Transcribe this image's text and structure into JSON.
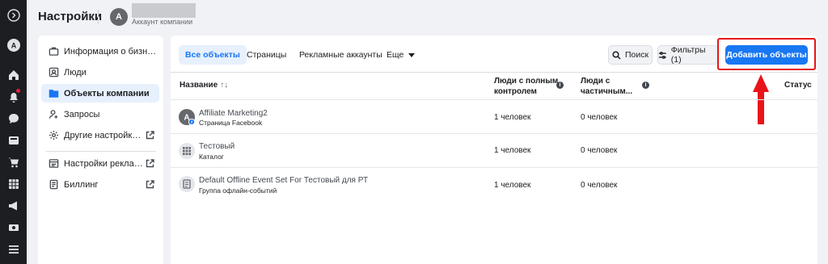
{
  "header": {
    "title": "Настройки",
    "account_initial": "A",
    "account_name": "Аккаунт компании"
  },
  "rail": {
    "icons": [
      "expand-icon",
      "account-icon",
      "home-icon",
      "notifications-icon",
      "chat-icon",
      "pages-icon",
      "shop-icon",
      "table-icon",
      "ads-icon",
      "money-icon",
      "menu-icon"
    ]
  },
  "sidebar": {
    "items": [
      {
        "label": "Информация о бизнес...",
        "icon": "briefcase-icon"
      },
      {
        "label": "Люди",
        "icon": "people-icon"
      },
      {
        "label": "Объекты компании",
        "icon": "folder-icon"
      },
      {
        "label": "Запросы",
        "icon": "user-request-icon"
      },
      {
        "label": "Другие настройки ко...",
        "icon": "gear-icon"
      },
      {
        "label": "Настройки рекламн...",
        "icon": "ad-settings-icon"
      },
      {
        "label": "Биллинг",
        "icon": "billing-icon"
      }
    ]
  },
  "tabs": [
    {
      "label": "Все объекты"
    },
    {
      "label": "Страницы"
    },
    {
      "label": "Рекламные аккаунты"
    },
    {
      "label": "Еще"
    }
  ],
  "toolbar": {
    "search_label": "Поиск",
    "filters_label": "Фильтры (1)",
    "add_label": "Добавить объекты"
  },
  "table": {
    "columns": {
      "name": "Название",
      "full_control_line1": "Люди с полным",
      "full_control_line2": "контролем",
      "partial_line1": "Люди с",
      "partial_line2": "частичным...",
      "status": "Статус"
    },
    "rows": [
      {
        "title": "Affiliate Marketing2",
        "subtitle": "Страница Facebook",
        "full": "1 человек",
        "partial": "0 человек"
      },
      {
        "title": "Тестовый",
        "subtitle": "Каталог",
        "full": "1 человек",
        "partial": "0 человек"
      },
      {
        "title": "Default Offline Event Set For Тестовый для РТ",
        "subtitle": "Группа офлайн-событий",
        "full": "1 человек",
        "partial": "0 человек"
      }
    ]
  },
  "colors": {
    "accent": "#1877f2",
    "highlight": "#e8141a",
    "rail_bg": "#1c1e21"
  }
}
